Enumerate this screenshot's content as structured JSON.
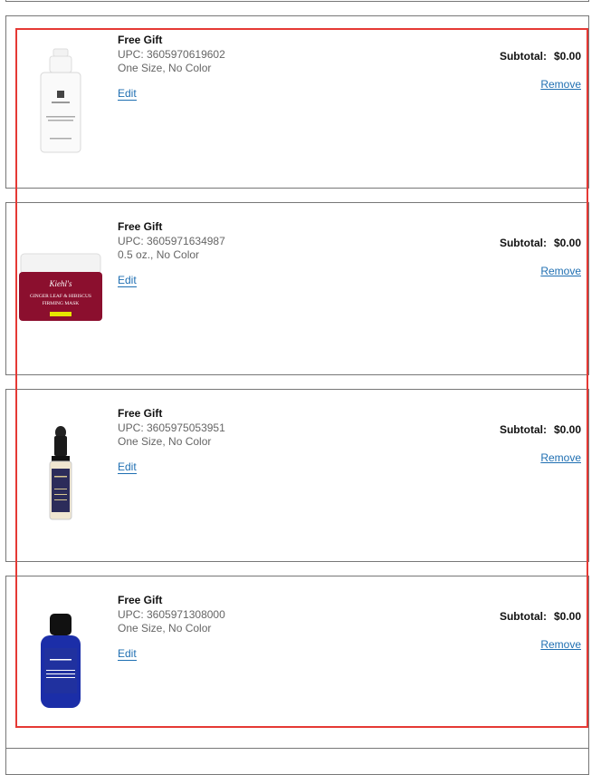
{
  "items": [
    {
      "title": "Free Gift",
      "upc": "UPC: 3605970619602",
      "variant": "One Size, No Color",
      "edit": "Edit",
      "subtotal_label": "Subtotal:",
      "subtotal_value": "$0.00",
      "remove": "Remove",
      "image": "serum-pump-bottle"
    },
    {
      "title": "Free Gift",
      "upc": "UPC: 3605971634987",
      "variant": "0.5 oz., No Color",
      "edit": "Edit",
      "subtotal_label": "Subtotal:",
      "subtotal_value": "$0.00",
      "remove": "Remove",
      "image": "firming-mask-jar",
      "jar_brand": "Kiehl's",
      "jar_line1": "GINGER LEAF & HIBISCUS",
      "jar_line2": "FIRMING MASK"
    },
    {
      "title": "Free Gift",
      "upc": "UPC: 3605975053951",
      "variant": "One Size, No Color",
      "edit": "Edit",
      "subtotal_label": "Subtotal:",
      "subtotal_value": "$0.00",
      "remove": "Remove",
      "image": "dropper-bottle"
    },
    {
      "title": "Free Gift",
      "upc": "UPC: 3605971308000",
      "variant": "One Size, No Color",
      "edit": "Edit",
      "subtotal_label": "Subtotal:",
      "subtotal_value": "$0.00",
      "remove": "Remove",
      "image": "cleansing-oil-bottle"
    }
  ],
  "colors": {
    "link": "#1f6fb2",
    "highlight": "#e53935",
    "border": "#777777"
  }
}
